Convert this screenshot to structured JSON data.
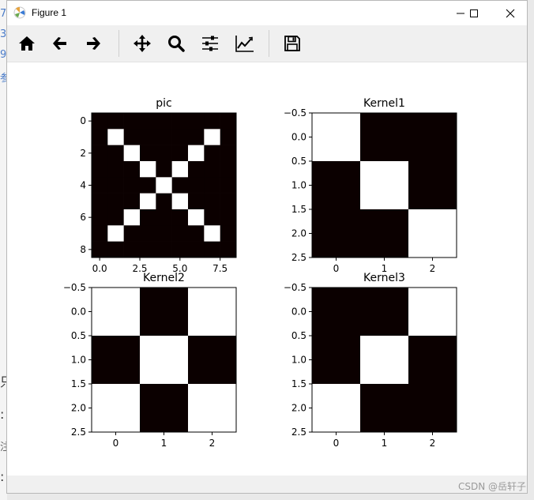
{
  "window": {
    "title": "Figure 1",
    "buttons": [
      "minimize",
      "maximize",
      "close"
    ]
  },
  "toolbar": {
    "buttons": [
      {
        "name": "home",
        "icon": "home-icon"
      },
      {
        "name": "back",
        "icon": "arrow-left-icon"
      },
      {
        "name": "forward",
        "icon": "arrow-right-icon"
      },
      {
        "name": "pan",
        "icon": "move-icon"
      },
      {
        "name": "zoom",
        "icon": "zoom-icon"
      },
      {
        "name": "configure-subplots",
        "icon": "sliders-icon"
      },
      {
        "name": "edit-axis",
        "icon": "chart-line-icon"
      },
      {
        "name": "save",
        "icon": "save-icon"
      }
    ]
  },
  "background_text": [
    "7",
    "3",
    "9",
    "参",
    "只",
    ":",
    "注",
    ":"
  ],
  "watermark": "CSDN @岳轩子",
  "colors": {
    "dark": "#0b0000",
    "light": "#ffffff"
  },
  "chart_data": [
    {
      "type": "heatmap",
      "title": "pic",
      "rows": 9,
      "cols": 9,
      "matrix": [
        [
          0,
          0,
          0,
          0,
          0,
          0,
          0,
          0,
          0
        ],
        [
          0,
          1,
          0,
          0,
          0,
          0,
          0,
          1,
          0
        ],
        [
          0,
          0,
          1,
          0,
          0,
          0,
          1,
          0,
          0
        ],
        [
          0,
          0,
          0,
          1,
          0,
          1,
          0,
          0,
          0
        ],
        [
          0,
          0,
          0,
          0,
          1,
          0,
          0,
          0,
          0
        ],
        [
          0,
          0,
          0,
          1,
          0,
          1,
          0,
          0,
          0
        ],
        [
          0,
          0,
          1,
          0,
          0,
          0,
          1,
          0,
          0
        ],
        [
          0,
          1,
          0,
          0,
          0,
          0,
          0,
          1,
          0
        ],
        [
          0,
          0,
          0,
          0,
          0,
          0,
          0,
          0,
          0
        ]
      ],
      "xticks": [
        "0.0",
        "2.5",
        "5.0",
        "7.5"
      ],
      "yticks": [
        "0",
        "2",
        "4",
        "6",
        "8"
      ]
    },
    {
      "type": "heatmap",
      "title": "Kernel1",
      "rows": 3,
      "cols": 3,
      "matrix": [
        [
          1,
          0,
          0
        ],
        [
          0,
          1,
          0
        ],
        [
          0,
          0,
          1
        ]
      ],
      "xticks": [
        "0",
        "1",
        "2"
      ],
      "yticks": [
        "−0.5",
        "0.0",
        "0.5",
        "1.0",
        "1.5",
        "2.0",
        "2.5"
      ]
    },
    {
      "type": "heatmap",
      "title": "Kernel2",
      "rows": 3,
      "cols": 3,
      "matrix": [
        [
          1,
          0,
          1
        ],
        [
          0,
          1,
          0
        ],
        [
          1,
          0,
          1
        ]
      ],
      "xticks": [
        "0",
        "1",
        "2"
      ],
      "yticks": [
        "−0.5",
        "0.0",
        "0.5",
        "1.0",
        "1.5",
        "2.0",
        "2.5"
      ]
    },
    {
      "type": "heatmap",
      "title": "Kernel3",
      "rows": 3,
      "cols": 3,
      "matrix": [
        [
          0,
          0,
          1
        ],
        [
          0,
          1,
          0
        ],
        [
          1,
          0,
          0
        ]
      ],
      "xticks": [
        "0",
        "1",
        "2"
      ],
      "yticks": [
        "−0.5",
        "0.0",
        "0.5",
        "1.0",
        "1.5",
        "2.0",
        "2.5"
      ]
    }
  ]
}
